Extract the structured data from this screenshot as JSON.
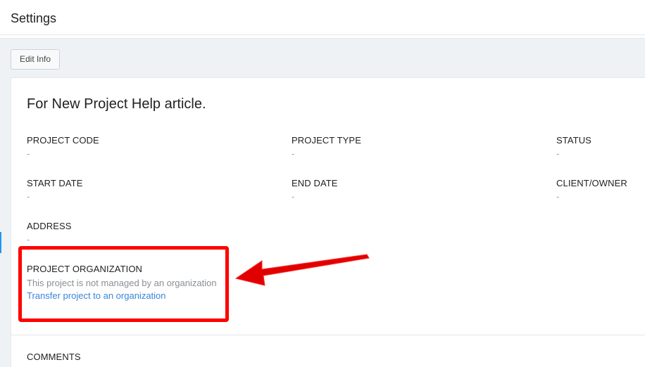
{
  "header": {
    "title": "Settings"
  },
  "toolbar": {
    "edit_label": "Edit Info"
  },
  "project": {
    "title": "For New Project Help article.",
    "fields": {
      "code": {
        "label": "PROJECT CODE",
        "value": "-"
      },
      "type": {
        "label": "PROJECT TYPE",
        "value": "-"
      },
      "status": {
        "label": "STATUS",
        "value": "-"
      },
      "start_date": {
        "label": "START DATE",
        "value": "-"
      },
      "end_date": {
        "label": "END DATE",
        "value": "-"
      },
      "client": {
        "label": "CLIENT/OWNER",
        "value": "-"
      },
      "address": {
        "label": "ADDRESS",
        "value": "-"
      }
    },
    "organization": {
      "label": "PROJECT ORGANIZATION",
      "description": "This project is not managed by an organization",
      "link": "Transfer project to an organization"
    },
    "comments": {
      "label": "COMMENTS"
    }
  },
  "colors": {
    "annotation": "#ff0000",
    "link": "#3a86d8",
    "toolbar_bg": "#eef2f5"
  }
}
